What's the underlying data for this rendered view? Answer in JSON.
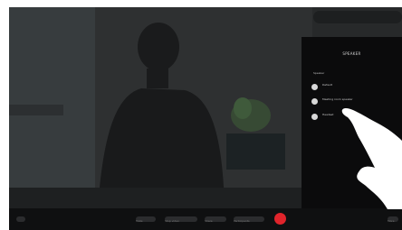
{
  "panel": {
    "title": "SPEAKER",
    "subtitle": "Speaker",
    "options": [
      {
        "label": "Default",
        "selected": false
      },
      {
        "label": "Meeting room speaker",
        "selected": false
      },
      {
        "label": "Headset",
        "selected": true
      }
    ]
  },
  "toolbar": {
    "buttons": [
      "Mute",
      "Stop video",
      "Share",
      "Participants",
      "More"
    ]
  },
  "colors": {
    "end_call": "#e0242b",
    "panel_bg": "#0b0b0c"
  }
}
